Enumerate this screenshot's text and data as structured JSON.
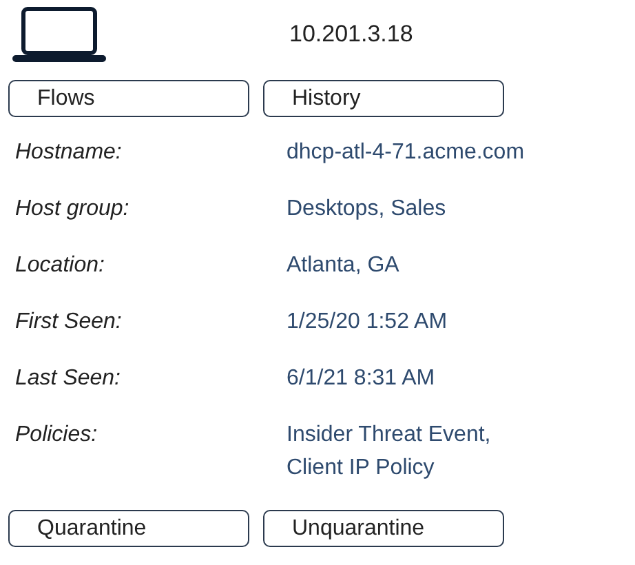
{
  "ip_address": "10.201.3.18",
  "tabs": [
    {
      "label": "Flows"
    },
    {
      "label": "History"
    }
  ],
  "details": [
    {
      "label": "Hostname:",
      "values": [
        "dhcp-atl-4-71.acme.com"
      ]
    },
    {
      "label": "Host group:",
      "values": [
        "Desktops, Sales"
      ]
    },
    {
      "label": "Location:",
      "values": [
        "Atlanta, GA"
      ]
    },
    {
      "label": "First Seen:",
      "values": [
        "1/25/20 1:52 AM"
      ]
    },
    {
      "label": "Last Seen:",
      "values": [
        "6/1/21 8:31 AM"
      ]
    },
    {
      "label": "Policies:",
      "values": [
        "Insider Threat Event,",
        "Client IP Policy"
      ]
    }
  ],
  "actions": [
    {
      "label": "Quarantine"
    },
    {
      "label": "Unquarantine"
    }
  ]
}
